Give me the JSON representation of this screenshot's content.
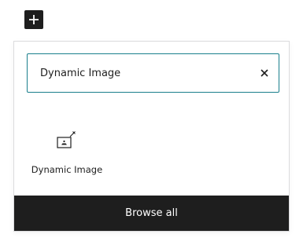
{
  "toggle": {
    "icon": "plus-icon"
  },
  "search": {
    "value": "Dynamic Image",
    "clear_icon": "close-icon"
  },
  "results": [
    {
      "label": "Dynamic Image",
      "icon": "dynamic-image-icon"
    }
  ],
  "footer": {
    "browse_label": "Browse all"
  },
  "colors": {
    "accent": "#1a7f8c",
    "dark": "#1e1e1e",
    "border": "#dcdcde"
  }
}
